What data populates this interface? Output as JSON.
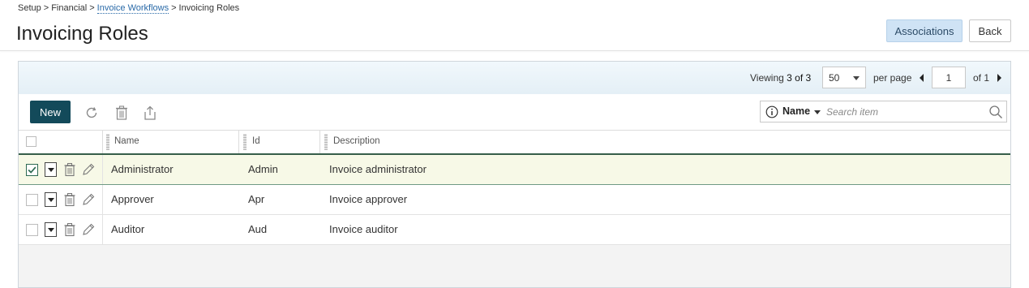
{
  "breadcrumb": {
    "items": [
      "Setup",
      "Financial",
      "Invoice Workflows",
      "Invoicing Roles"
    ],
    "separator": ">"
  },
  "page": {
    "title": "Invoicing Roles"
  },
  "header_actions": {
    "associations_label": "Associations",
    "back_label": "Back"
  },
  "pager": {
    "viewing_prefix": "Viewing",
    "viewing_range": "3 of 3",
    "per_page_value": "50",
    "per_page_label": "per page",
    "page_value": "1",
    "of_label": "of 1"
  },
  "toolbar": {
    "new_label": "New",
    "icons": [
      "refresh-icon",
      "trash-icon",
      "export-icon"
    ]
  },
  "search": {
    "field_label": "Name",
    "placeholder": "Search item"
  },
  "grid": {
    "columns": [
      "Name",
      "Id",
      "Description"
    ],
    "rows": [
      {
        "name": "Administrator",
        "id": "Admin",
        "description": "Invoice administrator",
        "selected": true
      },
      {
        "name": "Approver",
        "id": "Apr",
        "description": "Invoice approver",
        "selected": false
      },
      {
        "name": "Auditor",
        "id": "Aud",
        "description": "Invoice auditor",
        "selected": false
      }
    ]
  },
  "colors": {
    "primary_button": "#134a5a",
    "accent_button": "#cfe3f5",
    "selected_row": "#f7f9e7",
    "link": "#2a6aa8"
  }
}
